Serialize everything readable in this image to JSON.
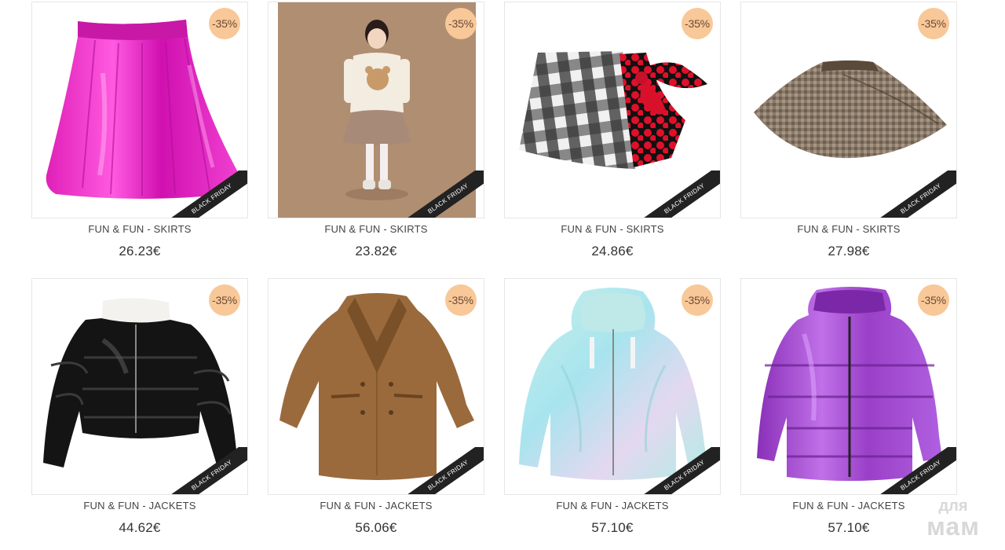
{
  "products": [
    {
      "title": "FUN & FUN - SKIRTS",
      "price": "26.23€",
      "discount": "-35%",
      "ribbon": "BLACK FRIDAY",
      "image": "pink-metallic-skirt"
    },
    {
      "title": "FUN & FUN - SKIRTS",
      "price": "23.82€",
      "discount": "-35%",
      "ribbon": "BLACK FRIDAY",
      "image": "girl-model-teddy-sweater-photo"
    },
    {
      "title": "FUN & FUN - SKIRTS",
      "price": "24.86€",
      "discount": "-35%",
      "ribbon": "BLACK FRIDAY",
      "image": "plaid-skirt-red-bow"
    },
    {
      "title": "FUN & FUN - SKIRTS",
      "price": "27.98€",
      "discount": "-35%",
      "ribbon": "BLACK FRIDAY",
      "image": "tweed-circle-skirt"
    },
    {
      "title": "FUN & FUN - JACKETS",
      "price": "44.62€",
      "discount": "-35%",
      "ribbon": "BLACK FRIDAY",
      "image": "black-puffer-jacket"
    },
    {
      "title": "FUN & FUN - JACKETS",
      "price": "56.06€",
      "discount": "-35%",
      "ribbon": "BLACK FRIDAY",
      "image": "brown-teddy-coat"
    },
    {
      "title": "FUN & FUN - JACKETS",
      "price": "57.10€",
      "discount": "-35%",
      "ribbon": "BLACK FRIDAY",
      "image": "iridescent-hooded-jacket"
    },
    {
      "title": "FUN & FUN - JACKETS",
      "price": "57.10€",
      "discount": "-35%",
      "ribbon": "BLACK FRIDAY",
      "image": "purple-puffer-jacket"
    }
  ],
  "watermark": {
    "top": "для",
    "bottom": "мам"
  },
  "colors": {
    "badge": "#f8c898",
    "ribbon": "#222222",
    "border": "#e6e6e6"
  }
}
